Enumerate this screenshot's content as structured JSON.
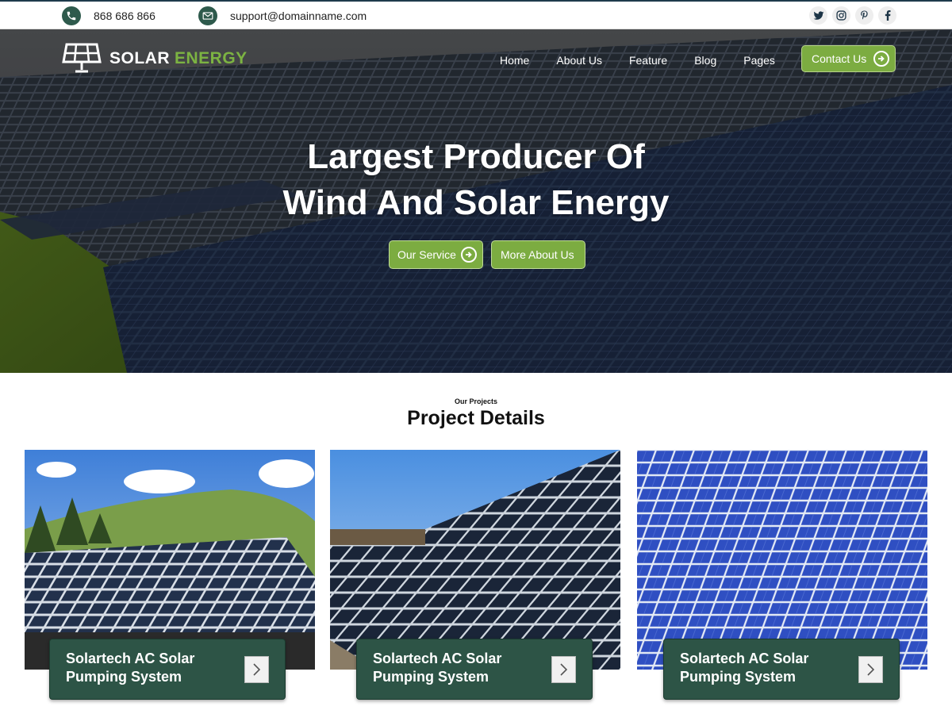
{
  "topbar": {
    "phone": "868 686 866",
    "email": "support@domainname.com",
    "socials": [
      "twitter-icon",
      "instagram-icon",
      "pinterest-icon",
      "facebook-icon"
    ]
  },
  "brand": {
    "word1": "SOLAR",
    "word2": "ENERGY"
  },
  "nav": {
    "items": [
      "Home",
      "About Us",
      "Feature",
      "Blog",
      "Pages"
    ],
    "cta_label": "Contact Us"
  },
  "hero": {
    "title_line1": "Largest Producer Of",
    "title_line2": "Wind And Solar Energy",
    "btn_primary": "Our Service",
    "btn_secondary": "More About Us"
  },
  "projects": {
    "kicker": "Our Projects",
    "title": "Project Details",
    "cards": [
      {
        "title": "Solartech  AC Solar Pumping System"
      },
      {
        "title": "Solartech  AC Solar Pumping System"
      },
      {
        "title": "Solartech  AC Solar Pumping System"
      }
    ]
  },
  "colors": {
    "accent_green": "#7cac41",
    "dark_green": "#2d5446",
    "brand_green": "#7cb342"
  }
}
